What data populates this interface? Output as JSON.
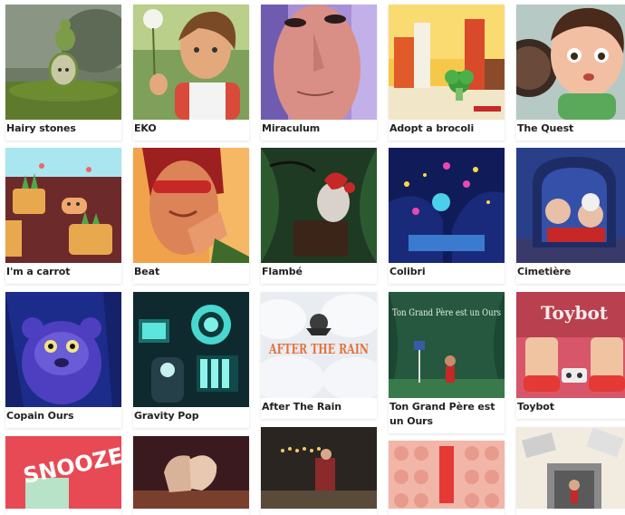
{
  "films": [
    {
      "title": "Hairy stones"
    },
    {
      "title": "EKO"
    },
    {
      "title": "Miraculum"
    },
    {
      "title": "Adopt a brocoli"
    },
    {
      "title": "The Quest"
    },
    {
      "title": "I'm a carrot"
    },
    {
      "title": "Beat"
    },
    {
      "title": "Flambé"
    },
    {
      "title": "Colibri"
    },
    {
      "title": "Cimetière"
    },
    {
      "title": "Copain Ours"
    },
    {
      "title": "Gravity Pop"
    },
    {
      "title": "After The Rain",
      "poster_text": "AFTER THE RAIN"
    },
    {
      "title": "Ton Grand Père est un Ours",
      "poster_text": "Ton Grand Père est un Ours"
    },
    {
      "title": "Toybot",
      "poster_text": "Toybot"
    },
    {
      "title": "",
      "poster_text": "SNOOZE"
    },
    {
      "title": ""
    },
    {
      "title": ""
    },
    {
      "title": ""
    },
    {
      "title": ""
    }
  ]
}
